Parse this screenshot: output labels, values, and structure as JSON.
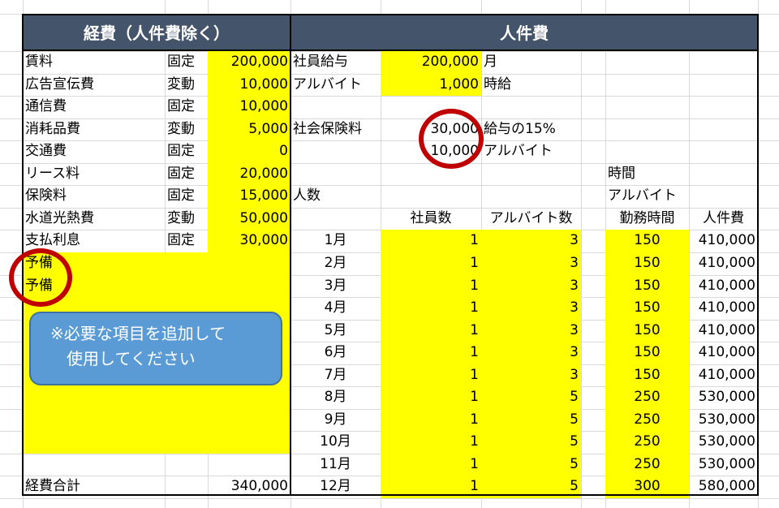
{
  "expense": {
    "title": "経費（人件費除く）",
    "rows": [
      {
        "name": "賃料",
        "type": "固定",
        "amount": "200,000"
      },
      {
        "name": "広告宣伝費",
        "type": "変動",
        "amount": "10,000"
      },
      {
        "name": "通信費",
        "type": "固定",
        "amount": "10,000"
      },
      {
        "name": "消耗品費",
        "type": "変動",
        "amount": "5,000"
      },
      {
        "name": "交通費",
        "type": "固定",
        "amount": "0"
      },
      {
        "name": "リース料",
        "type": "固定",
        "amount": "20,000"
      },
      {
        "name": "保険料",
        "type": "固定",
        "amount": "15,000"
      },
      {
        "name": "水道光熱費",
        "type": "変動",
        "amount": "50,000"
      },
      {
        "name": "支払利息",
        "type": "固定",
        "amount": "30,000"
      }
    ],
    "reserve": [
      "予備",
      "予備"
    ],
    "note_lines": [
      "※必要な項目を追加して",
      "使用してください"
    ],
    "total_label": "経費合計",
    "total_value": "340,000"
  },
  "personnel": {
    "title": "人件費",
    "salary_label": "社員給与",
    "salary_value": "200,000",
    "salary_unit": "月",
    "parttime_label": "アルバイト",
    "parttime_value": "1,000",
    "parttime_unit": "時給",
    "insurance_label": "社会保険料",
    "insurance_value1": "30,000",
    "insurance_note1": "給与の15%",
    "insurance_value2": "10,000",
    "insurance_note2": "アルバイト",
    "headcount_label": "人数",
    "col_hours_top": "時間",
    "col_hours_mid": "アルバイト",
    "col_employees": "社員数",
    "col_parttimers": "アルバイト数",
    "col_hours": "勤務時間",
    "col_cost": "人件費",
    "months": [
      {
        "month": "1月",
        "employees": "1",
        "parttimers": "3",
        "hours": "150",
        "cost": "410,000"
      },
      {
        "month": "2月",
        "employees": "1",
        "parttimers": "3",
        "hours": "150",
        "cost": "410,000"
      },
      {
        "month": "3月",
        "employees": "1",
        "parttimers": "3",
        "hours": "150",
        "cost": "410,000"
      },
      {
        "month": "4月",
        "employees": "1",
        "parttimers": "3",
        "hours": "150",
        "cost": "410,000"
      },
      {
        "month": "5月",
        "employees": "1",
        "parttimers": "3",
        "hours": "150",
        "cost": "410,000"
      },
      {
        "month": "6月",
        "employees": "1",
        "parttimers": "3",
        "hours": "150",
        "cost": "410,000"
      },
      {
        "month": "7月",
        "employees": "1",
        "parttimers": "3",
        "hours": "150",
        "cost": "410,000"
      },
      {
        "month": "8月",
        "employees": "1",
        "parttimers": "5",
        "hours": "250",
        "cost": "530,000"
      },
      {
        "month": "9月",
        "employees": "1",
        "parttimers": "5",
        "hours": "250",
        "cost": "530,000"
      },
      {
        "month": "10月",
        "employees": "1",
        "parttimers": "5",
        "hours": "250",
        "cost": "530,000"
      },
      {
        "month": "11月",
        "employees": "1",
        "parttimers": "5",
        "hours": "250",
        "cost": "530,000"
      },
      {
        "month": "12月",
        "employees": "1",
        "parttimers": "5",
        "hours": "300",
        "cost": "580,000"
      }
    ]
  },
  "colors": {
    "header_bg": "#44546a",
    "highlight": "#ffff00",
    "note_bg": "#5b9bd5",
    "circle": "#c00000",
    "gridline": "#d9d9d9"
  }
}
